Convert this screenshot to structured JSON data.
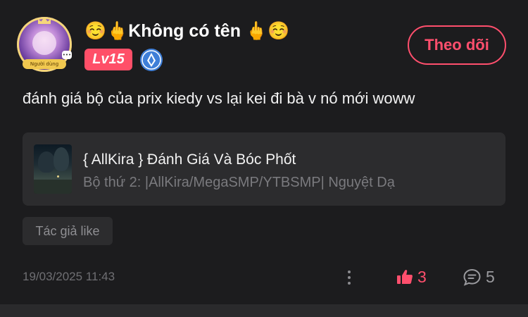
{
  "author": {
    "display_name": "☺️🖕Không có tên 🖕☺️",
    "level": "Lv15",
    "avatar_frame_text": "Người dùng",
    "avatar_badge_text": "•••",
    "rank_icon": "diamond-rank-icon"
  },
  "follow_button": {
    "label": "Theo dõi"
  },
  "post": {
    "text": "đánh giá bộ của prix kiedy vs lại kei đi bà v nó mới woww",
    "linked_card": {
      "title": "{ AllKira } Đánh Giá Và Bóc Phốt",
      "subtitle": "Bộ thứ 2: |AllKira/MegaSMP/YTBSMP| Nguyệt Dạ"
    },
    "tag": "Tác giả like",
    "timestamp": "19/03/2025 11:43"
  },
  "stats": {
    "likes": "3",
    "comments": "5"
  },
  "colors": {
    "background": "#1c1c1e",
    "card": "#2c2c2e",
    "accent": "#ff4f6d",
    "level_badge": "#ff4f68",
    "muted_text": "#6f6f73"
  }
}
